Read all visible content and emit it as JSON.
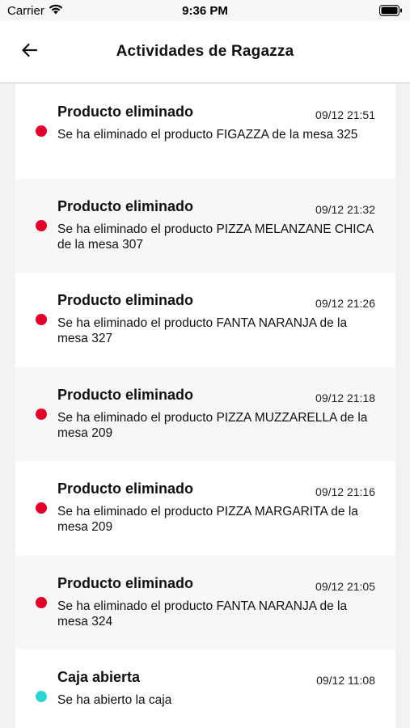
{
  "status_bar": {
    "carrier": "Carrier",
    "time": "9:36 PM",
    "icons": [
      "wifi-icon",
      "battery-icon"
    ]
  },
  "header": {
    "title": "Actividades de Ragazza",
    "back_icon": "back-arrow-icon"
  },
  "colors": {
    "deleted_dot": "#e0002a",
    "opened_dot": "#2fd3d3"
  },
  "activities": [
    {
      "title": "Producto eliminado",
      "time": "09/12 21:51",
      "description": "Se ha eliminado el producto FIGAZZA de la mesa 325",
      "status": "deleted"
    },
    {
      "title": "Producto eliminado",
      "time": "09/12 21:32",
      "description": "Se ha eliminado el producto PIZZA MELANZANE CHICA de la mesa 307",
      "status": "deleted"
    },
    {
      "title": "Producto eliminado",
      "time": "09/12 21:26",
      "description": "Se ha eliminado el producto FANTA NARANJA de la mesa 327",
      "status": "deleted"
    },
    {
      "title": "Producto eliminado",
      "time": "09/12 21:18",
      "description": "Se ha eliminado el producto PIZZA MUZZARELLA de la mesa 209",
      "status": "deleted"
    },
    {
      "title": "Producto eliminado",
      "time": "09/12 21:16",
      "description": "Se ha eliminado el producto PIZZA MARGARITA de la mesa 209",
      "status": "deleted"
    },
    {
      "title": "Producto eliminado",
      "time": "09/12 21:05",
      "description": "Se ha eliminado el producto FANTA NARANJA de la mesa 324",
      "status": "deleted"
    },
    {
      "title": "Caja abierta",
      "time": "09/12 11:08",
      "description": "Se ha abierto la caja",
      "status": "opened"
    }
  ]
}
